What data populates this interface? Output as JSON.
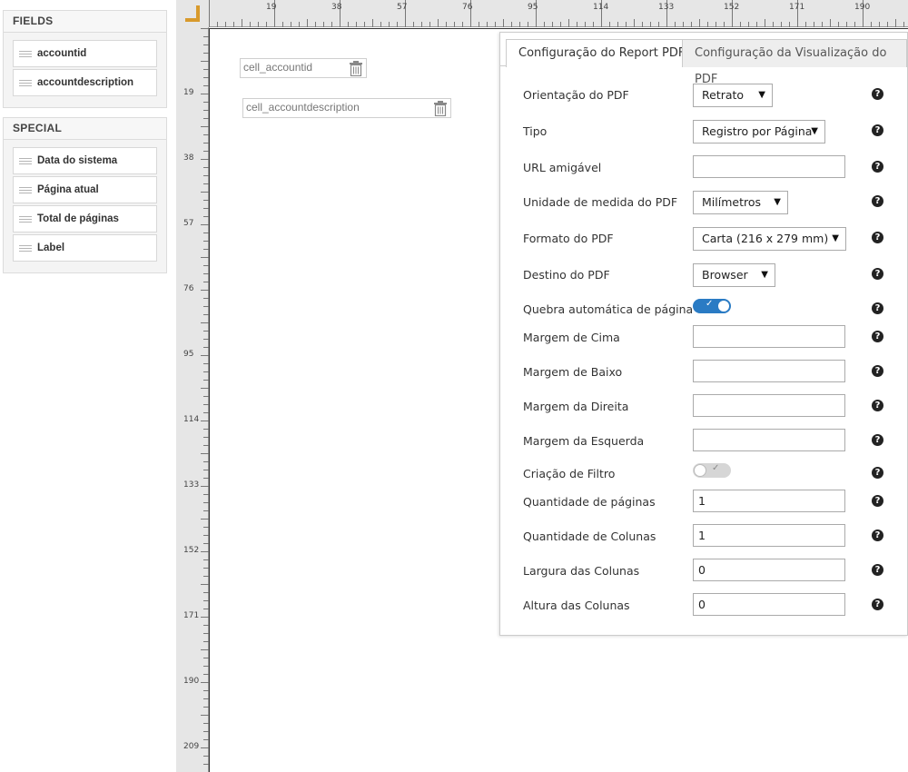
{
  "fields_panel": {
    "title": "FIELDS",
    "items": [
      {
        "label": "accountid"
      },
      {
        "label": "accountdescription"
      }
    ]
  },
  "special_panel": {
    "title": "SPECIAL",
    "items": [
      {
        "label": "Data do sistema"
      },
      {
        "label": "Página atual"
      },
      {
        "label": "Total de páginas"
      },
      {
        "label": "Label"
      }
    ]
  },
  "ruler": {
    "top_labels": [
      "19",
      "38",
      "57",
      "76",
      "95",
      "114",
      "133",
      "152",
      "171",
      "190"
    ],
    "left_labels": [
      "19",
      "38",
      "57",
      "76",
      "95",
      "114",
      "133",
      "152",
      "171",
      "190",
      "209"
    ]
  },
  "cells": [
    {
      "label": "cell_accountid"
    },
    {
      "label": "cell_accountdescription"
    }
  ],
  "settings": {
    "tabs": [
      {
        "label": "Configuração do Report PDF",
        "active": true
      },
      {
        "label": "Configuração da Visualização do PDF",
        "active": false
      }
    ],
    "rows": {
      "orientacao": {
        "label": "Orientação do PDF",
        "value": "Retrato"
      },
      "tipo": {
        "label": "Tipo",
        "value": "Registro por Página"
      },
      "url": {
        "label": "URL amigável",
        "value": ""
      },
      "unidade": {
        "label": "Unidade de medida do PDF",
        "value": "Milímetros"
      },
      "formato": {
        "label": "Formato do PDF",
        "value": "Carta (216 x 279 mm)"
      },
      "destino": {
        "label": "Destino do PDF",
        "value": "Browser"
      },
      "quebra": {
        "label": "Quebra automática de página",
        "on": true
      },
      "margem_cima": {
        "label": "Margem de Cima",
        "value": ""
      },
      "margem_baixo": {
        "label": "Margem de Baixo",
        "value": ""
      },
      "margem_direita": {
        "label": "Margem da Direita",
        "value": ""
      },
      "margem_esquerda": {
        "label": "Margem da Esquerda",
        "value": ""
      },
      "filtro": {
        "label": "Criação de Filtro",
        "on": false
      },
      "qtd_paginas": {
        "label": "Quantidade de páginas",
        "value": "1"
      },
      "qtd_colunas": {
        "label": "Quantidade de Colunas",
        "value": "1"
      },
      "largura_colunas": {
        "label": "Largura das Colunas",
        "value": "0"
      },
      "altura_colunas": {
        "label": "Altura das Colunas",
        "value": "0"
      }
    },
    "help_glyph": "?",
    "check_glyph": "✓",
    "caret_glyph": "▼",
    "toggle_on_color": "#2a7bc4"
  }
}
